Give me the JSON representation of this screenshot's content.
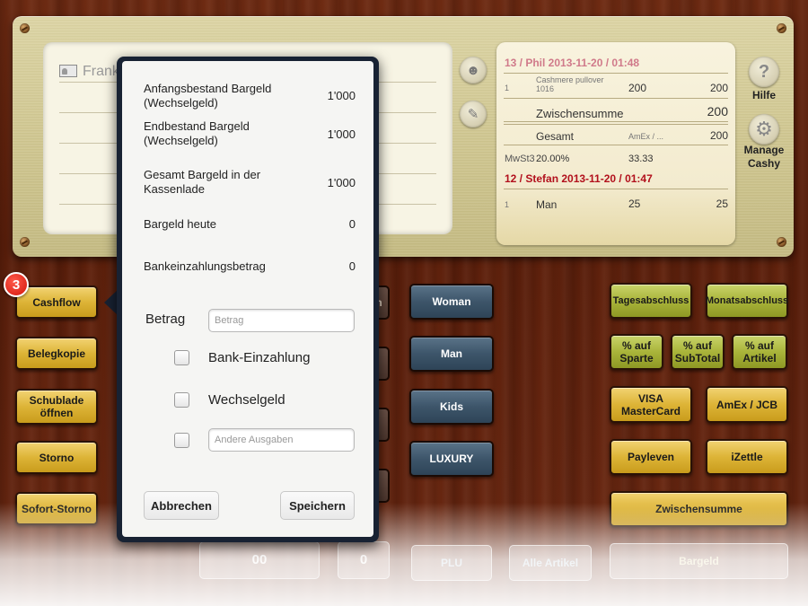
{
  "customer": {
    "name": "Frank"
  },
  "receipt": {
    "order1": {
      "header": "13 / Phil  2013-11-20 / 01:48",
      "qty": "1",
      "product": "Cashmere pullover",
      "product_code": "1016",
      "unit_price": "200",
      "total": "200"
    },
    "subtotal_label": "Zwischensumme",
    "subtotal_value": "200",
    "total_label": "Gesamt",
    "total_method": "AmEx / ...",
    "total_value": "200",
    "tax_label": "MwSt3",
    "tax_rate": "20.00%",
    "tax_value": "33.33",
    "order2": {
      "header": "12 / Stefan  2013-11-20 / 01:47",
      "qty": "1",
      "product": "Man",
      "unit_price": "25",
      "total": "25"
    }
  },
  "side": {
    "help_label": "Hilfe",
    "help_glyph": "?",
    "manage_label": "Manage Cashy",
    "manage_glyph": "⚙"
  },
  "badge": "3",
  "left_buttons": [
    "Cashflow",
    "Belegkopie",
    "Schublade öffnen",
    "Storno",
    "Sofort-Storno"
  ],
  "category_buttons": [
    "Woman",
    "Man",
    "Kids",
    "LUXURY"
  ],
  "hidden_fragment": "n",
  "right_buttons": {
    "tagesabschluss": "Tagesabschluss",
    "monatsabschluss": "Monatsabschluss",
    "pct_sparte": "% auf Sparte",
    "pct_subtotal": "% auf SubTotal",
    "pct_artikel": "% auf Artikel",
    "visa": "VISA MasterCard",
    "amex": "AmEx / JCB",
    "payleven": "Payleven",
    "izettle": "iZettle",
    "zwischensumme": "Zwischensumme",
    "bargeld": "Bargeld"
  },
  "bottom_row": {
    "num_00": "00",
    "num_0": "0",
    "plu": "PLU",
    "alle_artikel": "Alle Artikel"
  },
  "popover": {
    "rows": [
      {
        "label": "Anfangsbestand Bargeld (Wechselgeld)",
        "value": "1'000"
      },
      {
        "label": "Endbestand Bargeld (Wechselgeld)",
        "value": "1'000"
      },
      {
        "label": "Gesamt Bargeld in der Kassenlade",
        "value": "1'000"
      },
      {
        "label": "Bargeld heute",
        "value": "0"
      },
      {
        "label": "Bankeinzahlungsbetrag",
        "value": "0"
      }
    ],
    "amount_label": "Betrag",
    "amount_placeholder": "Betrag",
    "option_bank": "Bank-Einzahlung",
    "option_change": "Wechselgeld",
    "other_placeholder": "Andere Ausgaben",
    "cancel_label": "Abbrechen",
    "save_label": "Speichern"
  }
}
